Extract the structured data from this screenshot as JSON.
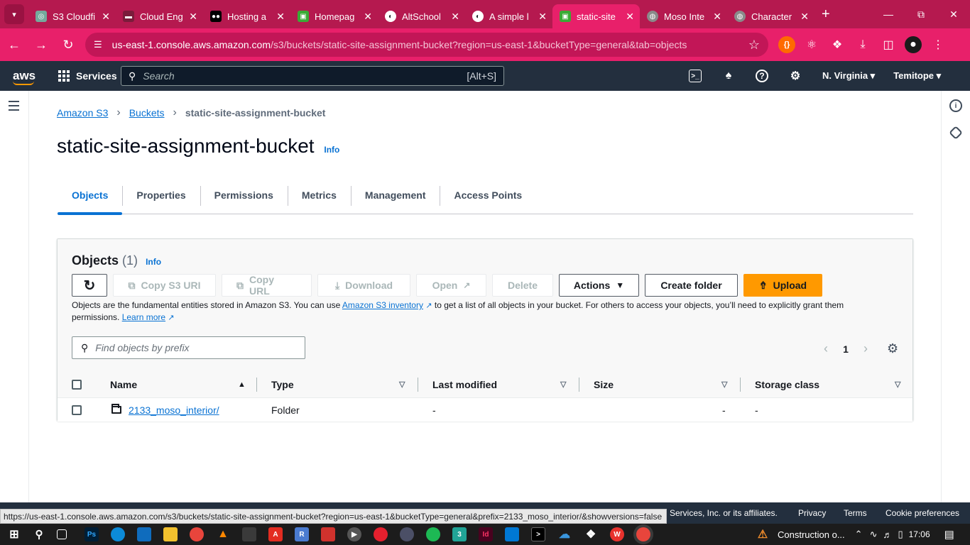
{
  "browser": {
    "tabs": [
      {
        "title": "S3 Cloudfi",
        "fav_color": "#74aa9c",
        "fav_glyph": "◎",
        "active": false
      },
      {
        "title": "Cloud Eng",
        "fav_color": "#7b1c3b",
        "fav_glyph": "▬",
        "active": false
      },
      {
        "title": "Hosting a",
        "fav_color": "#000000",
        "fav_glyph": "●●",
        "active": false
      },
      {
        "title": "Homepag",
        "fav_color": "#3aaa35",
        "fav_glyph": "▣",
        "active": false
      },
      {
        "title": "AltSchool",
        "fav_color": "#24292f",
        "fav_glyph": "◐",
        "active": false
      },
      {
        "title": "A simple l",
        "fav_color": "#24292f",
        "fav_glyph": "◐",
        "active": false
      },
      {
        "title": "static-site",
        "fav_color": "#3aaa35",
        "fav_glyph": "▣",
        "active": true
      },
      {
        "title": "Moso Inte",
        "fav_color": "#8a8a8a",
        "fav_glyph": "◍",
        "active": false
      },
      {
        "title": "Character",
        "fav_color": "#8a8a8a",
        "fav_glyph": "◍",
        "active": false
      }
    ],
    "url_host": "us-east-1.console.aws.amazon.com",
    "url_path": "/s3/buckets/static-site-assignment-bucket?region=us-east-1&bucketType=general&tab=objects",
    "status_url": "https://us-east-1.console.aws.amazon.com/s3/buckets/static-site-assignment-bucket?region=us-east-1&bucketType=general&prefix=2133_moso_interior/&showversions=false"
  },
  "aws_nav": {
    "logo": "aws",
    "services": "Services",
    "search_placeholder": "Search",
    "search_hint": "[Alt+S]",
    "region": "N. Virginia ▾",
    "user": "Temitope ▾"
  },
  "breadcrumb": {
    "root": "Amazon S3",
    "buckets": "Buckets",
    "current": "static-site-assignment-bucket"
  },
  "page": {
    "title": "static-site-assignment-bucket",
    "info": "Info"
  },
  "tabs": [
    "Objects",
    "Properties",
    "Permissions",
    "Metrics",
    "Management",
    "Access Points"
  ],
  "objects": {
    "title": "Objects",
    "count": "(1)",
    "info": "Info",
    "buttons": {
      "copy_uri": "Copy S3 URI",
      "copy_url": "Copy URL",
      "download": "Download",
      "open": "Open",
      "delete": "Delete",
      "actions": "Actions",
      "create_folder": "Create folder",
      "upload": "Upload"
    },
    "desc_pre": "Objects are the fundamental entities stored in Amazon S3. You can use ",
    "desc_link": "Amazon S3 inventory",
    "desc_post": " to get a list of all objects in your bucket. For others to access your objects, you’ll need to explicitly grant them permissions. ",
    "learn_more": "Learn more",
    "find_placeholder": "Find objects by prefix",
    "page_number": "1",
    "columns": [
      "Name",
      "Type",
      "Last modified",
      "Size",
      "Storage class"
    ],
    "rows": [
      {
        "name": "2133_moso_interior/",
        "type": "Folder",
        "last_modified": "-",
        "size": "-",
        "storage_class": "-"
      }
    ]
  },
  "footer": {
    "copyright": "Services, Inc. or its affiliates.",
    "privacy": "Privacy",
    "terms": "Terms",
    "cookies": "Cookie preferences"
  },
  "taskbar": {
    "weather": "Construction o...",
    "time": "17:06"
  },
  "colors": {
    "chrome_tabstrip": "#b5194f",
    "chrome_toolbar": "#e8206a",
    "aws_nav": "#232f3e",
    "link": "#0972d3",
    "upload": "#ff9900"
  }
}
